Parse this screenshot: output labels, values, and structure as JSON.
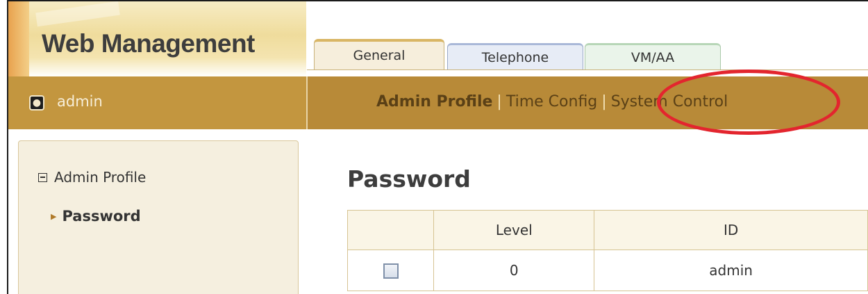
{
  "app": {
    "title": "Web Management"
  },
  "tabs": [
    {
      "label": "General",
      "active": true
    },
    {
      "label": "Telephone",
      "active": false
    },
    {
      "label": "VM/AA",
      "active": false
    }
  ],
  "user": {
    "name": "admin",
    "icon": "user-badge-icon"
  },
  "subnav": {
    "items": [
      "Admin Profile",
      "Time Config",
      "System Control"
    ],
    "separator": "|",
    "active": "Admin Profile",
    "highlighted": "System Control"
  },
  "sidebar": {
    "section": "Admin Profile",
    "items": [
      {
        "label": "Password",
        "selected": true
      }
    ]
  },
  "main": {
    "title": "Password",
    "table": {
      "headers": [
        "",
        "Level",
        "ID"
      ],
      "rows": [
        {
          "checked": false,
          "level": "0",
          "id": "admin"
        }
      ]
    }
  },
  "colors": {
    "bar": "#b88a38",
    "highlight": "#e3252e",
    "tab_general": "#f6eedc",
    "tab_telephone": "#e7ecf6",
    "tab_vmaa": "#eaf4ea"
  }
}
